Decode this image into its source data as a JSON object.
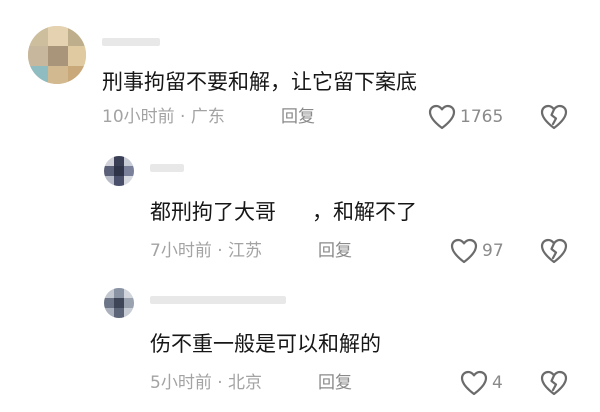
{
  "comments": [
    {
      "text": "刑事拘留不要和解，让它留下案底",
      "time": "10小时前",
      "location": "广东",
      "reply_label": "回复",
      "likes": "1765"
    },
    {
      "text_part1": "都刑拘了大哥",
      "text_part2": "，和解不了",
      "time": "7小时前",
      "location": "江苏",
      "reply_label": "回复",
      "likes": "97"
    },
    {
      "text": "伤不重一般是可以和解的",
      "time": "5小时前",
      "location": "北京",
      "reply_label": "回复",
      "likes": "4"
    }
  ],
  "meta_separator": "·",
  "colors": {
    "text": "#161616",
    "meta": "#a3a3a3",
    "icon": "#6b6b6b"
  }
}
